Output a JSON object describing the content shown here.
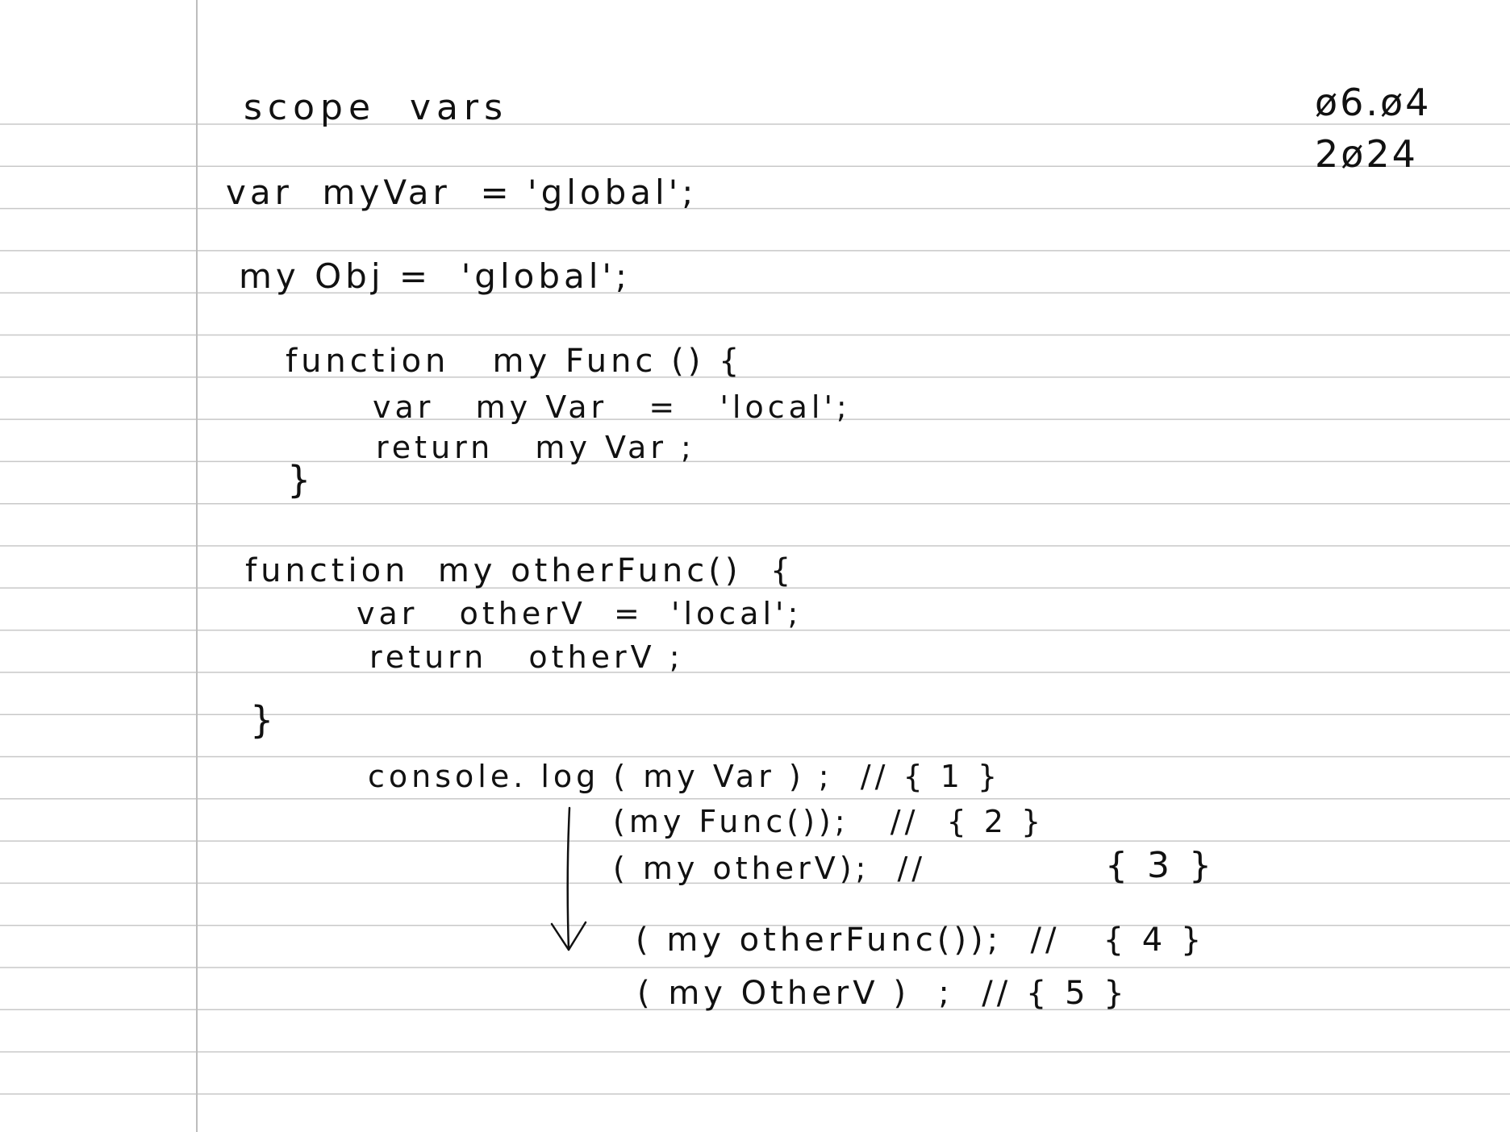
{
  "note": {
    "title": "scope  vars",
    "date_line1": "ø6.ø4",
    "date_line2": "2ø24",
    "lines": {
      "l1": "var  myVar  = 'global';",
      "l2": "my Obj =  'global';",
      "l3": "function   my Func () {",
      "l4": "var   my Var   =   'local';",
      "l5": "return   my Var ;",
      "l6": "}",
      "l7": "function  my otherFunc()  {",
      "l8": "var   otherV  =  'local';",
      "l9": "return   otherV ;",
      "l10": "}",
      "l11": "console. log ( my Var ) ;  // { 1 }",
      "l12": "(my Func());   //  { 2 }",
      "l13": "( my otherV);  //",
      "l13b": "{ 3 }",
      "l14": "( my otherFunc());  //   { 4 }",
      "l15": "( my OtherV )  ;  // { 5 }"
    }
  },
  "colors": {
    "ink": "#111111",
    "rule_lines": "#c8c8c8",
    "margin_line": "#bdbdbd",
    "paper": "#ffffff"
  }
}
